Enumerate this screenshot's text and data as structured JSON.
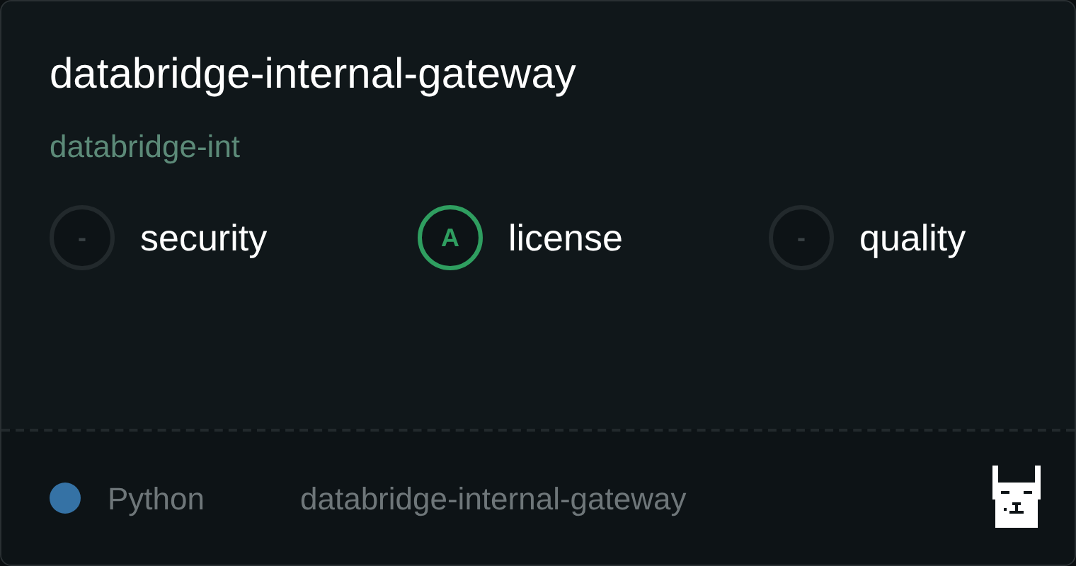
{
  "title": "databridge-internal-gateway",
  "owner": "databridge-int",
  "scores": [
    {
      "grade": "-",
      "label": "security",
      "color": "#22292c"
    },
    {
      "grade": "A",
      "label": "license",
      "color": "#2f9e60"
    },
    {
      "grade": "-",
      "label": "quality",
      "color": "#22292c"
    }
  ],
  "footer": {
    "language": "Python",
    "color": "#3572a5",
    "repo": "databridge-internal-gateway"
  }
}
